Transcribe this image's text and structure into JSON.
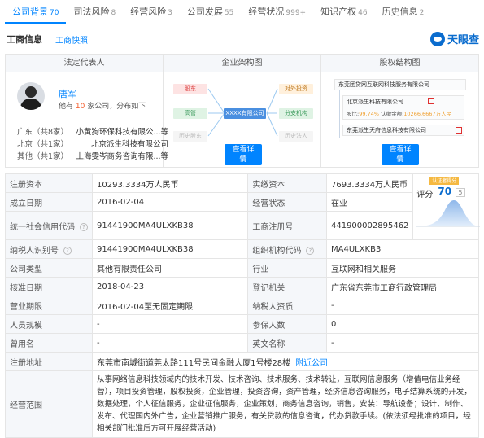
{
  "tabs": [
    {
      "label": "公司背景",
      "count": "70"
    },
    {
      "label": "司法风险",
      "count": "8"
    },
    {
      "label": "经营风险",
      "count": "3"
    },
    {
      "label": "公司发展",
      "count": "55"
    },
    {
      "label": "经营状况",
      "count": "999+"
    },
    {
      "label": "知识产权",
      "count": "46"
    },
    {
      "label": "历史信息",
      "count": "2"
    }
  ],
  "subhead": {
    "title": "工商信息",
    "link": "工商快照",
    "logo": "天眼查"
  },
  "panels": {
    "rep_head": "法定代表人",
    "arch_head": "企业架构图",
    "equity_head": "股权结构图"
  },
  "rep": {
    "name": "唐军",
    "info_pre": "他有",
    "info_num": "10",
    "info_post": "家公司，分布如下",
    "rows": [
      {
        "region": "广东（共8家）",
        "company": "小黄狗环保科技有限公...等"
      },
      {
        "region": "北京（共1家）",
        "company": "北京派生科技有限公司"
      },
      {
        "region": "其他（共1家）",
        "company": "上海雯岑商务咨询有限...等"
      }
    ]
  },
  "arch": {
    "nodes": {
      "shareholder": "股东",
      "exec": "高管",
      "history": "历史股东",
      "center": "XXXX有限公司",
      "invest": "对外投资",
      "branch": "分支机构",
      "legal": "历史法人"
    },
    "button": [
      "查看详",
      "情"
    ]
  },
  "equity": {
    "top": "东莞团贷网互联网科技服务有限公司",
    "mid": "北京派生科技有限公司",
    "mid_ratio_label": "股比:",
    "mid_ratio": "99.74%",
    "mid_capital_label": "认缴金额:",
    "mid_capital": "10266.6667万人民",
    "bottom": "东莞派生天府信息科技有限公司",
    "button": [
      "查看详",
      "情"
    ]
  },
  "score": {
    "badge": "认证者得分",
    "label": "评分",
    "value": "70",
    "max": "5"
  },
  "table": {
    "reg_capital_label": "注册资本",
    "reg_capital": "10293.3334万人民币",
    "paid_capital_label": "实缴资本",
    "paid_capital": "7693.3334万人民币",
    "est_date_label": "成立日期",
    "est_date": "2016-02-04",
    "status_label": "经营状态",
    "status": "在业",
    "credit_code_label": "统一社会信用代码",
    "credit_code": "91441900MA4ULXKB38",
    "reg_no_label": "工商注册号",
    "reg_no": "441900002895462",
    "tax_id_label": "纳税人识别号",
    "tax_id": "91441900MA4ULXKB38",
    "org_code_label": "组织机构代码",
    "org_code": "MA4ULXKB3",
    "company_type_label": "公司类型",
    "company_type": "其他有限责任公司",
    "industry_label": "行业",
    "industry": "互联网和相关服务",
    "approve_date_label": "核准日期",
    "approve_date": "2018-04-23",
    "authority_label": "登记机关",
    "authority": "广东省东莞市工商行政管理局",
    "term_label": "营业期限",
    "term": "2016-02-04至无固定期限",
    "taxpayer_label": "纳税人资质",
    "taxpayer": "-",
    "staff_label": "人员规模",
    "staff": "-",
    "insured_label": "参保人数",
    "insured": "0",
    "former_name_label": "曾用名",
    "former_name": "-",
    "english_name_label": "英文名称",
    "english_name": "-",
    "address_label": "注册地址",
    "address": "东莞市南城街道莞太路111号民间金融大厦1号楼28楼",
    "address_link": "附近公司",
    "scope_label": "经营范围",
    "scope": "从事网络信息科技领域内的技术开发、技术咨询、技术服务、技术转让，互联网信息服务（增值电信业务经营），项目投资管理，股权投资，企业管理，投资咨询，资产管理，经济信息咨询服务，电子结算系统的开发，数据处理，个人征信服务，企业征信服务，企业策划，商务信息咨询，销售，安装：导航设备；设计、制作、发布、代理国内外广告，企业营销推广服务，有关贷款的信息咨询，代办贷款手续。(依法须经批准的项目，经相关部门批准后方可开展经营活动)"
  },
  "colors": {
    "accent": "#0084ff",
    "green": "#3cb371",
    "orange": "#f0a030",
    "red": "#e03030"
  }
}
